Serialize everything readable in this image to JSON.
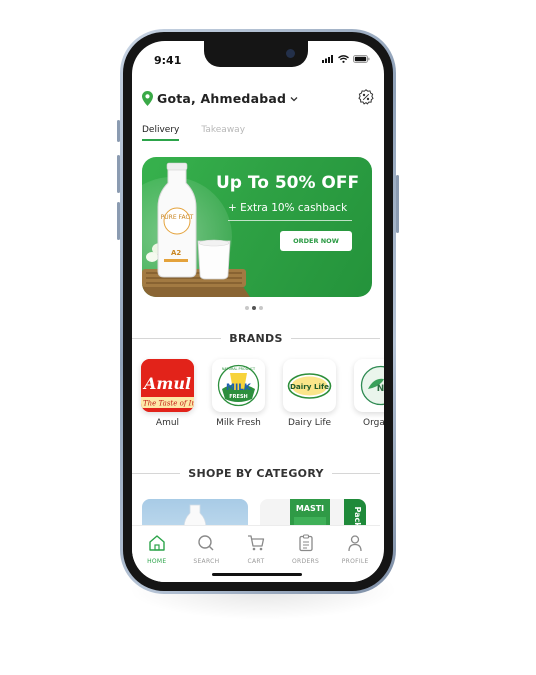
{
  "status": {
    "time": "9:41"
  },
  "location": {
    "name": "Gota, Ahmedabad",
    "pin_icon": "location-pin-icon",
    "chevron_icon": "chevron-down-icon",
    "offer_icon": "discount-badge-icon"
  },
  "tabs": [
    {
      "label": "Delivery",
      "active": true
    },
    {
      "label": "Takeaway",
      "active": false
    }
  ],
  "banner": {
    "title": "Up To 50% OFF",
    "subtitle": "+ Extra 10% cashback",
    "cta": "ORDER NOW",
    "bottle_label_top": "PURE FACT",
    "bottle_label_bottom": "A2",
    "carousel": {
      "count": 3,
      "active_index": 1
    },
    "color": "#2ea144"
  },
  "brands_section": {
    "title": "BRANDS",
    "items": [
      {
        "label": "Amul",
        "logo_text": "Amul",
        "tagline": "The Taste of India"
      },
      {
        "label": "Milk Fresh",
        "logo_text": "MILK",
        "logo_sub": "FRESH",
        "logo_ring": "NATURAL PRODUCT"
      },
      {
        "label": "Dairy Life",
        "logo_text": "Dairy Life"
      },
      {
        "label": "Organic",
        "logo_text": "NA"
      }
    ]
  },
  "category_section": {
    "title": "SHOPE BY CATEGORY",
    "items": [
      {
        "name": "milk-category"
      },
      {
        "name": "masti-buttermilk-category",
        "pack_text": "MASTI",
        "side_text": "Pack"
      }
    ]
  },
  "bottom_nav": [
    {
      "label": "HOME",
      "icon": "home-icon",
      "active": true
    },
    {
      "label": "SEARCH",
      "icon": "search-icon",
      "active": false
    },
    {
      "label": "CART",
      "icon": "cart-icon",
      "active": false
    },
    {
      "label": "ORDERS",
      "icon": "orders-icon",
      "active": false
    },
    {
      "label": "PROFILE",
      "icon": "profile-icon",
      "active": false
    }
  ],
  "colors": {
    "accent": "#2ca44a",
    "banner": "#2ea144",
    "amul_red": "#e2231a"
  }
}
